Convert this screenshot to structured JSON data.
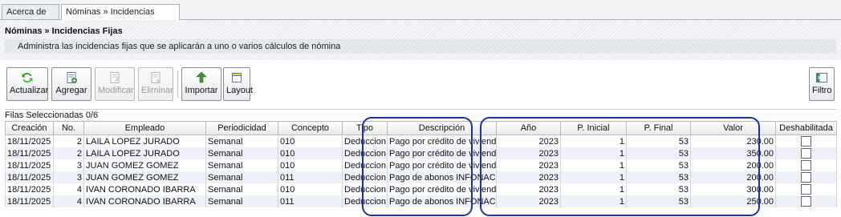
{
  "tabs": [
    {
      "label": "Acerca de"
    },
    {
      "label": "Nóminas » Incidencias Fijas",
      "close": "✕"
    }
  ],
  "header": {
    "title": "Nóminas » Incidencias Fijas",
    "subtitle": "Administra las incidencias fijas que se aplicarán a uno o varios cálculos de nómina"
  },
  "toolbar": {
    "refresh": {
      "label": "Actualizar",
      "icon": "refresh-icon"
    },
    "add": {
      "label": "Agregar",
      "icon": "add-document-icon"
    },
    "edit": {
      "label": "Modificar",
      "icon": "edit-document-icon"
    },
    "delete": {
      "label": "Eliminar",
      "icon": "delete-document-icon"
    },
    "import": {
      "label": "Importar",
      "icon": "import-arrow-icon"
    },
    "layout": {
      "label": "Layout",
      "icon": "layout-icon"
    },
    "filter": {
      "label": "Filtro",
      "icon": "filter-icon"
    }
  },
  "selection": {
    "text": "Filas Seleccionadas 0/6"
  },
  "grid": {
    "columns": [
      "Creación",
      "No.",
      "Empleado",
      "Periodicidad",
      "Concepto",
      "Tipo",
      "Descripción",
      "Año",
      "P. Inicial",
      "P. Final",
      "Valor",
      "Deshabilitada"
    ],
    "rows": [
      {
        "creacion": "18/11/2025",
        "no": "2",
        "empleado": "LAILA LOPEZ JURADO",
        "periodicidad": "Semanal",
        "concepto": "010",
        "tipo": "Deduccion",
        "descripcion": "Pago por crédito de vivienda",
        "anio": "2023",
        "p_inicial": "1",
        "p_final": "53",
        "valor": "230.00",
        "deshabilitada": false
      },
      {
        "creacion": "18/11/2025",
        "no": "2",
        "empleado": "LAILA LOPEZ JURADO",
        "periodicidad": "Semanal",
        "concepto": "010",
        "tipo": "Deduccion",
        "descripcion": "Pago por crédito de vivienda",
        "anio": "2023",
        "p_inicial": "1",
        "p_final": "53",
        "valor": "350.00",
        "deshabilitada": false
      },
      {
        "creacion": "18/11/2025",
        "no": "3",
        "empleado": "JUAN GOMEZ GOMEZ",
        "periodicidad": "Semanal",
        "concepto": "010",
        "tipo": "Deduccion",
        "descripcion": "Pago por crédito de vivienda",
        "anio": "2023",
        "p_inicial": "1",
        "p_final": "53",
        "valor": "200.00",
        "deshabilitada": false
      },
      {
        "creacion": "18/11/2025",
        "no": "3",
        "empleado": "JUAN GOMEZ GOMEZ",
        "periodicidad": "Semanal",
        "concepto": "011",
        "tipo": "Deduccion",
        "descripcion": "Pago de abonos INFONACOT",
        "anio": "2023",
        "p_inicial": "1",
        "p_final": "53",
        "valor": "200.00",
        "deshabilitada": false
      },
      {
        "creacion": "18/11/2025",
        "no": "4",
        "empleado": "IVAN CORONADO IBARRA",
        "periodicidad": "Semanal",
        "concepto": "010",
        "tipo": "Deduccion",
        "descripcion": "Pago por crédito de vivienda",
        "anio": "2023",
        "p_inicial": "1",
        "p_final": "53",
        "valor": "300.00",
        "deshabilitada": false
      },
      {
        "creacion": "18/11/2025",
        "no": "4",
        "empleado": "IVAN CORONADO IBARRA",
        "periodicidad": "Semanal",
        "concepto": "011",
        "tipo": "Deduccion",
        "descripcion": "Pago de abonos INFONACOT",
        "anio": "2023",
        "p_inicial": "1",
        "p_final": "53",
        "valor": "250.00",
        "deshabilitada": false
      }
    ]
  },
  "colors": {
    "highlight": "#1f2fa8",
    "row_alt": "#eef2f8"
  }
}
